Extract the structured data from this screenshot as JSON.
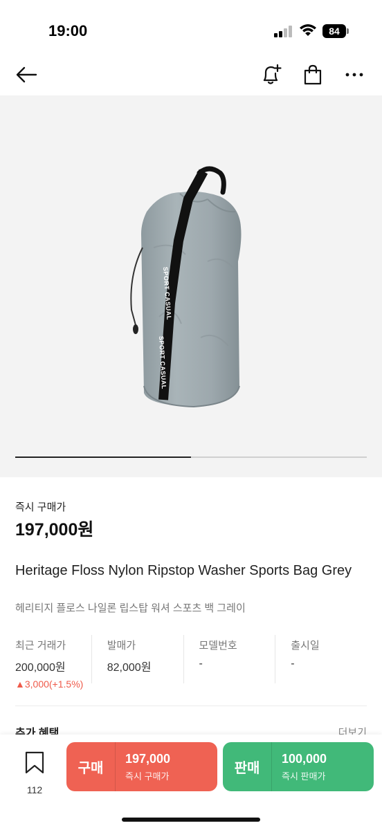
{
  "status_bar": {
    "time": "19:00",
    "battery": "84"
  },
  "nav": {
    "back_icon": "arrow-left-icon",
    "alert_icon": "bell-plus-icon",
    "bag_icon": "shopping-bag-icon",
    "more_icon": "more-horizontal-icon"
  },
  "product_image": {
    "print_text": "SPORT CASUAL",
    "carousel_progress": 0.5
  },
  "price": {
    "label": "즉시 구매가",
    "value": "197,000원"
  },
  "title": {
    "en": "Heritage Floss Nylon Ripstop Washer Sports Bag Grey",
    "ko": "헤리티지 플로스 나일론 립스탑 워셔 스포츠 백 그레이"
  },
  "info": [
    {
      "label": "최근 거래가",
      "value": "200,000원",
      "change": "▲3,000(+1.5%)"
    },
    {
      "label": "발매가",
      "value": "82,000원"
    },
    {
      "label": "모델번호",
      "value": "-"
    },
    {
      "label": "출시일",
      "value": "-"
    }
  ],
  "benefit": {
    "title": "추가 혜택",
    "more": "더보기"
  },
  "bottom": {
    "bookmark_count": "112",
    "buy": {
      "label": "구매",
      "price": "197,000",
      "sub": "즉시 구매가"
    },
    "sell": {
      "label": "판매",
      "price": "100,000",
      "sub": "즉시 판매가"
    }
  },
  "colors": {
    "buy": "#ef6253",
    "sell": "#41b979",
    "price_up": "#ef5a4a",
    "image_bg": "#f3f3f3"
  }
}
